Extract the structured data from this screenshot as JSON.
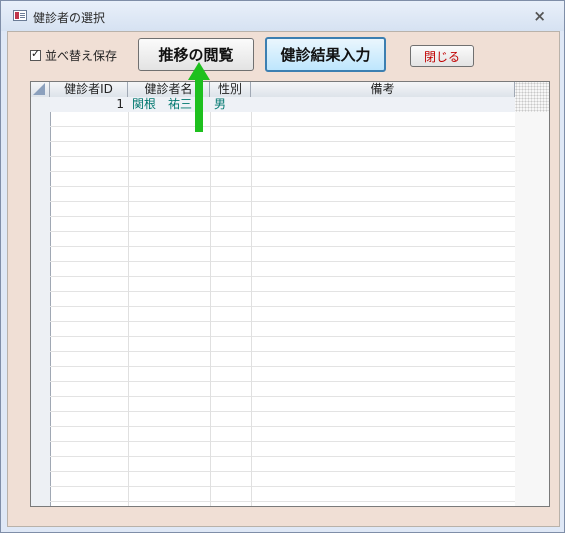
{
  "window": {
    "title": "健診者の選択"
  },
  "toolbar": {
    "sort_save_label": "並べ替え保存",
    "trend_button": "推移の閲覧",
    "result_button": "健診結果入力",
    "close_button": "閉じる"
  },
  "grid": {
    "columns": [
      "健診者ID",
      "健診者名",
      "性別",
      "備考"
    ],
    "rows": [
      {
        "id": "1",
        "name": "関根　祐三",
        "sex": "男",
        "note": ""
      }
    ]
  },
  "colors": {
    "arrow": "#1ec01e",
    "teal_text": "#00776f",
    "close_text": "#c00000"
  },
  "icons": {
    "title": "form-icon",
    "close": "close-icon",
    "annotation": "up-arrow-icon"
  }
}
